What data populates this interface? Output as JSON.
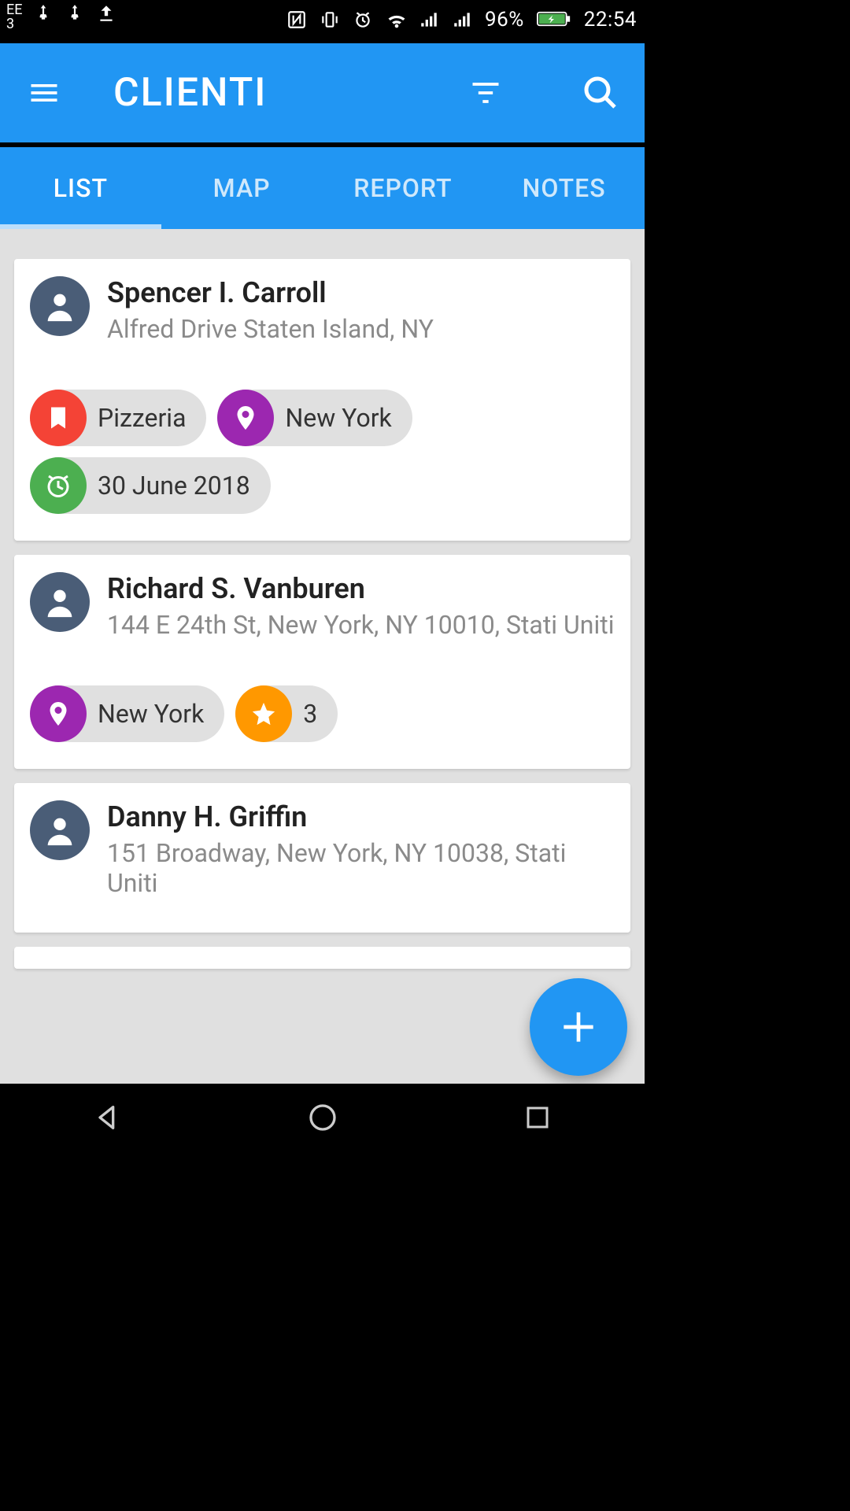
{
  "status_bar": {
    "carrier_top": "EE",
    "carrier_bottom": "3",
    "battery": "96%",
    "time": "22:54"
  },
  "header": {
    "title": "CLIENTI"
  },
  "tabs": {
    "list": "LIST",
    "map": "MAP",
    "report": "REPORT",
    "notes": "NOTES",
    "active": "list"
  },
  "clients": [
    {
      "name": "Spencer I. Carroll",
      "address": "Alfred Drive Staten Island, NY",
      "chips": [
        {
          "kind": "bookmark",
          "color": "red",
          "label": "Pizzeria"
        },
        {
          "kind": "pin",
          "color": "purple",
          "label": "New York"
        },
        {
          "kind": "alarm",
          "color": "green",
          "label": "30 June 2018"
        }
      ]
    },
    {
      "name": "Richard S. Vanburen",
      "address": "144 E 24th St, New York, NY 10010, Stati Uniti",
      "chips": [
        {
          "kind": "pin",
          "color": "purple",
          "label": "New York"
        },
        {
          "kind": "star",
          "color": "orange",
          "label": "3"
        }
      ]
    },
    {
      "name": "Danny H. Griffin",
      "address": "151 Broadway, New York, NY 10038, Stati Uniti",
      "chips": []
    }
  ],
  "colors": {
    "primary": "#2196F3",
    "chip_red": "#f44336",
    "chip_purple": "#9c27b0",
    "chip_green": "#4caf50",
    "chip_orange": "#ff9800",
    "avatar": "#4a5d77"
  }
}
